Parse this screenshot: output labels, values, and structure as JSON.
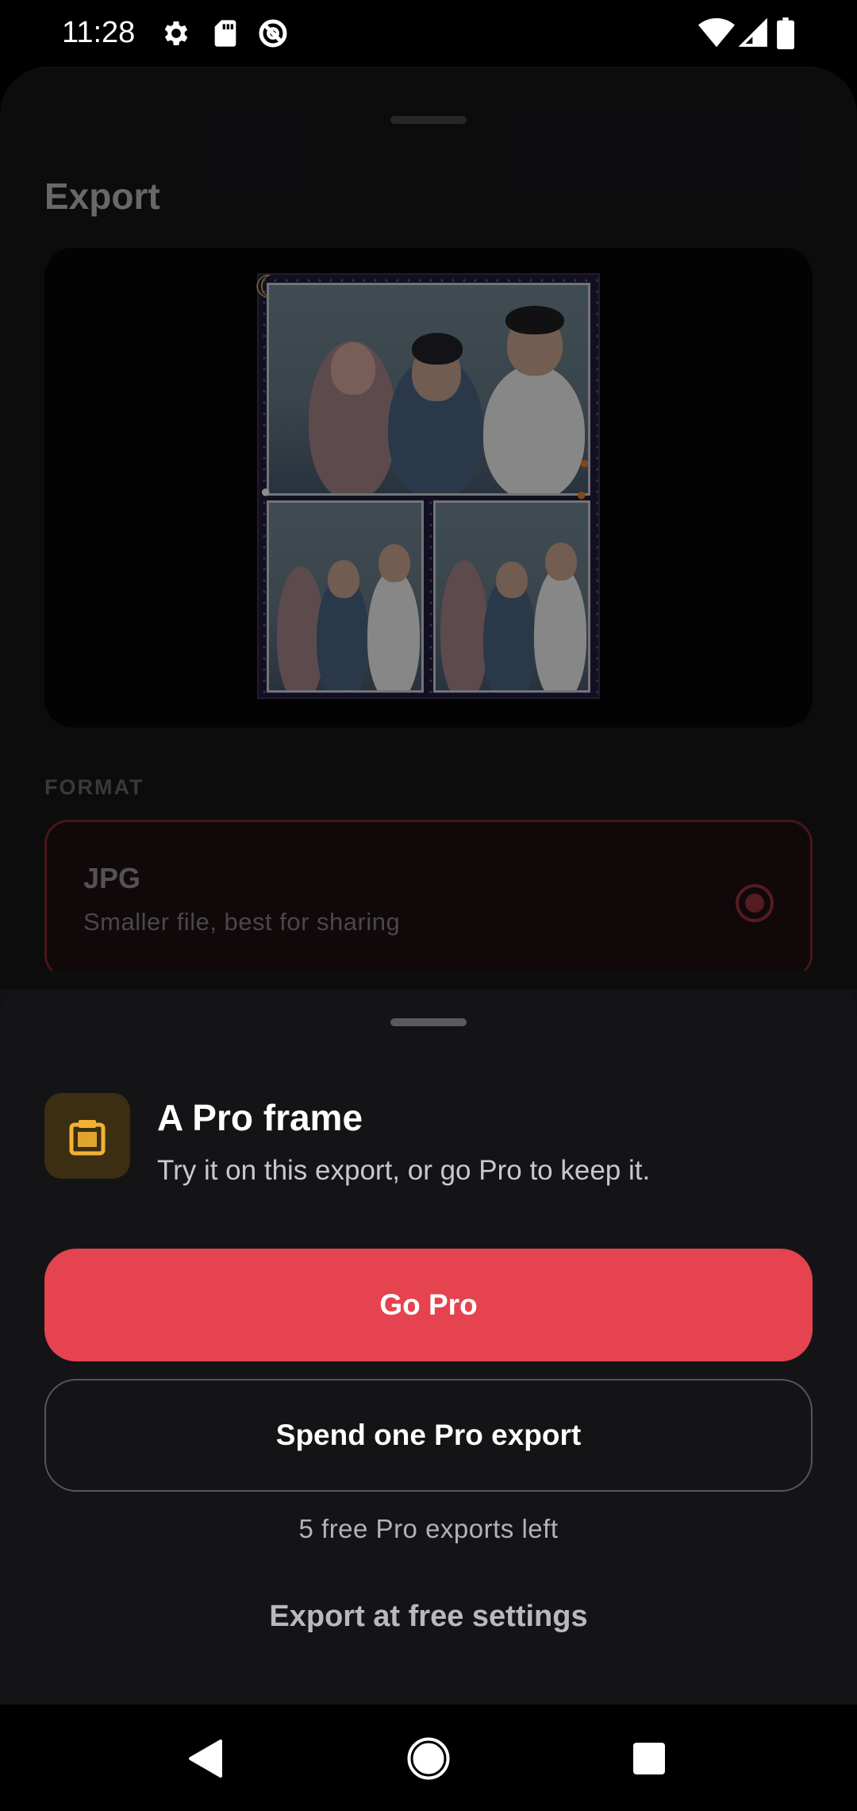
{
  "status_bar": {
    "time": "11:28",
    "icons_left": [
      "gear-icon",
      "sd-card-icon",
      "data-saver-icon"
    ],
    "icons_right": [
      "wifi-icon",
      "signal-icon",
      "battery-icon"
    ]
  },
  "export_screen": {
    "title": "Export",
    "format_section_label": "FORMAT",
    "format_option": {
      "name": "JPG",
      "description": "Smaller file, best for sharing",
      "selected": true
    }
  },
  "pro_sheet": {
    "icon": "pro-frame-icon",
    "title": "A Pro frame",
    "subtitle": "Try it on this export, or go Pro to keep it.",
    "go_pro_label": "Go Pro",
    "spend_label": "Spend one Pro export",
    "remaining_text": "5 free Pro exports left",
    "free_export_label": "Export at free settings"
  },
  "nav_bar": {
    "buttons": [
      "back-icon",
      "home-icon",
      "recents-icon"
    ]
  },
  "colors": {
    "accent": "#e5434f",
    "pro_icon": "#f2b233",
    "pro_icon_bg": "#3b2e12",
    "sheet_bg": "#141416"
  }
}
